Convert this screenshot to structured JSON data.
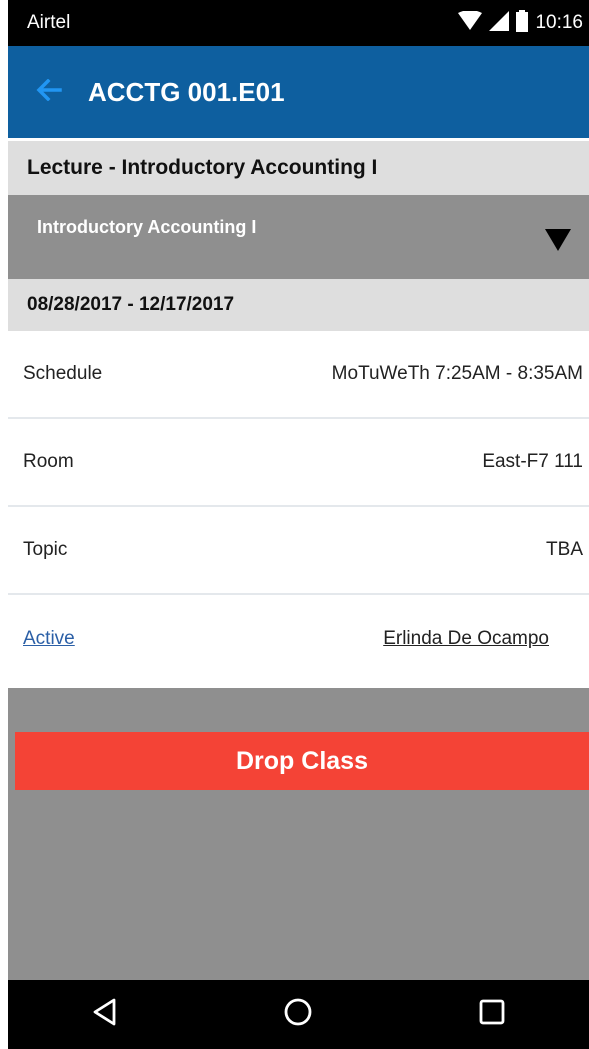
{
  "status_bar": {
    "carrier": "Airtel",
    "time": "10:16",
    "icons": [
      "wifi-icon",
      "signal-icon",
      "battery-icon"
    ]
  },
  "app_bar": {
    "back_icon": "back-arrow-icon",
    "title": "ACCTG 001.E01",
    "color": "#0e5f9f"
  },
  "section": {
    "title": "Lecture - Introductory Accounting I"
  },
  "course_select": {
    "selected": "Introductory Accounting I",
    "arrow_icon": "dropdown-triangle-icon"
  },
  "date_range": "08/28/2017 - 12/17/2017",
  "details": {
    "schedule": {
      "label": "Schedule",
      "value": "MoTuWeTh 7:25AM - 8:35AM"
    },
    "room": {
      "label": "Room",
      "value": "East-F7 111"
    },
    "topic": {
      "label": "Topic",
      "value": "TBA"
    },
    "status": {
      "label": "Active",
      "instructor": "Erlinda De Ocampo"
    }
  },
  "actions": {
    "drop_label": "Drop Class",
    "drop_color": "#f44336"
  },
  "nav_bar": {
    "icons": [
      "nav-back-icon",
      "nav-home-icon",
      "nav-recents-icon"
    ]
  }
}
